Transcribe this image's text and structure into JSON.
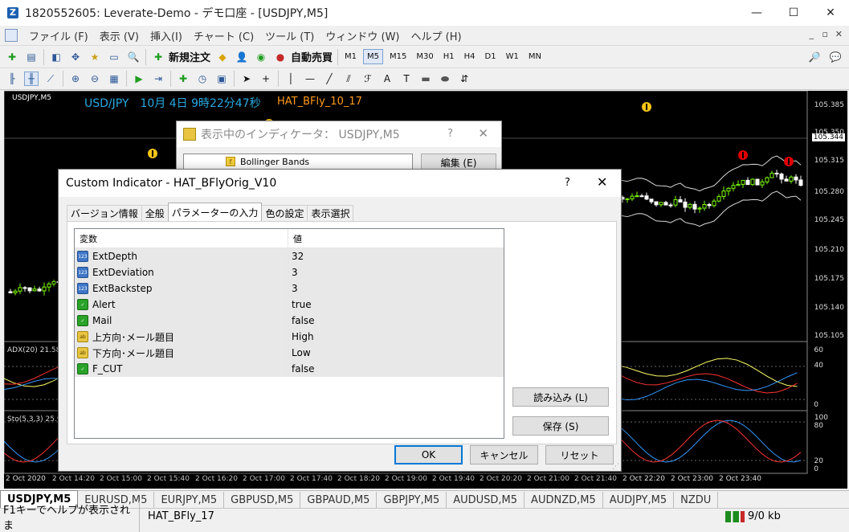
{
  "window": {
    "title": "1820552605: Leverate-Demo - デモ口座 - [USDJPY,M5]",
    "app_icon": "Z"
  },
  "menu": [
    "ファイル (F)",
    "表示 (V)",
    "挿入(I)",
    "チャート (C)",
    "ツール (T)",
    "ウィンドウ (W)",
    "ヘルプ (H)"
  ],
  "toolbar1": {
    "new_order": "新規注文",
    "auto_trade": "自動売買",
    "timeframes": [
      "M1",
      "M5",
      "M15",
      "M30",
      "H1",
      "H4",
      "D1",
      "W1",
      "MN"
    ],
    "selected_tf": "M5"
  },
  "chart": {
    "symbol": "USDJPY,M5",
    "clock": "USD/JPY　10月 4日 9時22分47秒",
    "indicator_name": "HAT_BFly_10_17",
    "current_price": "105.344",
    "price_labels": [
      "105.385",
      "105.350",
      "105.315",
      "105.280",
      "105.245",
      "105.210",
      "105.175",
      "105.140",
      "105.105"
    ],
    "adx_label": "ADX(20) 21.58",
    "adx_scale": [
      "60",
      "40",
      "0"
    ],
    "sto_label": "Sto(5,3,3) 25.9",
    "sto_scale": [
      "100",
      "80",
      "20",
      "0"
    ],
    "x_labels": [
      "2 Oct 2020",
      "2 Oct 14:20",
      "2 Oct 15:00",
      "2 Oct 15:40",
      "2 Oct 16:20",
      "2 Oct 17:00",
      "2 Oct 17:40",
      "2 Oct 18:20",
      "2 Oct 19:00",
      "2 Oct 19:40",
      "2 Oct 20:20",
      "2 Oct 21:00",
      "2 Oct 21:40",
      "2 Oct 22:20",
      "2 Oct 23:00",
      "2 Oct 23:40"
    ]
  },
  "dialog_back": {
    "title": "表示中のインディケータ： USDJPY,M5",
    "help": "?",
    "close": "✕",
    "list_item": "Bollinger Bands",
    "edit": "編集 (E)"
  },
  "dialog": {
    "title": "Custom Indicator - HAT_BFlyOrig_V10",
    "help": "?",
    "close": "✕",
    "tabs": [
      "バージョン情報",
      "全般",
      "パラメーターの入力",
      "色の設定",
      "表示選択"
    ],
    "active_tab": "パラメーターの入力",
    "col_var": "変数",
    "col_val": "値",
    "params": [
      {
        "name": "ExtDepth",
        "value": "32",
        "type": "123"
      },
      {
        "name": "ExtDeviation",
        "value": "3",
        "type": "123"
      },
      {
        "name": "ExtBackstep",
        "value": "3",
        "type": "123"
      },
      {
        "name": "Alert",
        "value": "true",
        "type": "bool"
      },
      {
        "name": "Mail",
        "value": "false",
        "type": "bool"
      },
      {
        "name": "上方向･メール題目",
        "value": "High",
        "type": "ab"
      },
      {
        "name": "下方向･メール題目",
        "value": "Low",
        "type": "ab"
      },
      {
        "name": "F_CUT",
        "value": "false",
        "type": "bool"
      }
    ],
    "load_btn": "読み込み (L)",
    "save_btn": "保存 (S)",
    "ok": "OK",
    "cancel": "キャンセル",
    "reset": "リセット"
  },
  "tabs": [
    "USDJPY,M5",
    "EURUSD,M5",
    "EURJPY,M5",
    "GBPUSD,M5",
    "GBPAUD,M5",
    "GBPJPY,M5",
    "AUDUSD,M5",
    "AUDNZD,M5",
    "AUDJPY,M5",
    "NZDU"
  ],
  "status": {
    "help": "F1キーでヘルプが表示されま",
    "profile": "HAT_BFly_17",
    "traffic": "9/0 kb"
  },
  "colors": {
    "bull": "#7cfc00",
    "bear": "#ffffff",
    "band": "#d8d8d8",
    "clock": "#29a8e0",
    "indicator": "#ff9a1a"
  }
}
